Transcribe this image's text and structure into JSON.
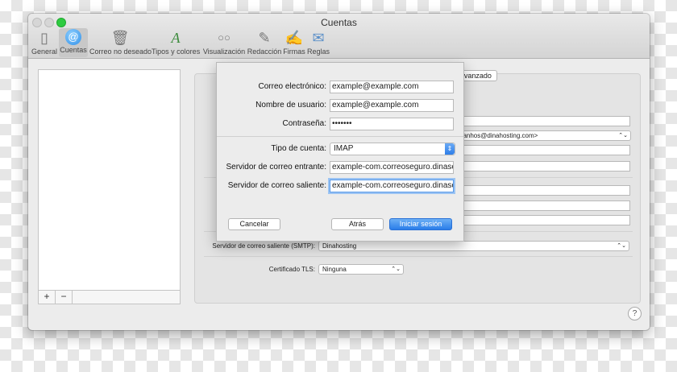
{
  "window": {
    "title": "Cuentas"
  },
  "toolbar": {
    "items": [
      {
        "label": "General",
        "icon": "switch-icon"
      },
      {
        "label": "Cuentas",
        "icon": "at-icon",
        "selected": true
      },
      {
        "label": "Correo no deseado",
        "icon": "trash-icon"
      },
      {
        "label": "Tipos y colores",
        "icon": "font-icon"
      },
      {
        "label": "Visualización",
        "icon": "glasses-icon"
      },
      {
        "label": "Redacción",
        "icon": "pencil-icon"
      },
      {
        "label": "Firmas",
        "icon": "signature-icon"
      },
      {
        "label": "Reglas",
        "icon": "rules-icon"
      }
    ]
  },
  "sidebar": {
    "add_symbol": "+",
    "remove_symbol": "−"
  },
  "background": {
    "avanzado_tab": "Avanzado",
    "email_partial": "banhos@dinahosting.com>",
    "smtp_label": "Servidor de correo saliente (SMTP):",
    "smtp_value": "Dinahosting",
    "tls_label": "Certificado TLS:",
    "tls_value": "Ninguna"
  },
  "sheet": {
    "email_label": "Correo electrónico:",
    "email_value": "example@example.com",
    "username_label": "Nombre de usuario:",
    "username_value": "example@example.com",
    "password_label": "Contraseña:",
    "password_value": "•••••••",
    "account_type_label": "Tipo de cuenta:",
    "account_type_value": "IMAP",
    "incoming_label": "Servidor de correo entrante:",
    "incoming_value": "example-com.correoseguro.dinaser",
    "outgoing_label": "Servidor de correo saliente:",
    "outgoing_value": "example-com.correoseguro.dinaser",
    "cancel_label": "Cancelar",
    "back_label": "Atrás",
    "signin_label": "Iniciar sesión"
  },
  "help": {
    "symbol": "?"
  },
  "colors": {
    "accent": "#2f7ee8",
    "zoom_button": "#2ecb40"
  }
}
